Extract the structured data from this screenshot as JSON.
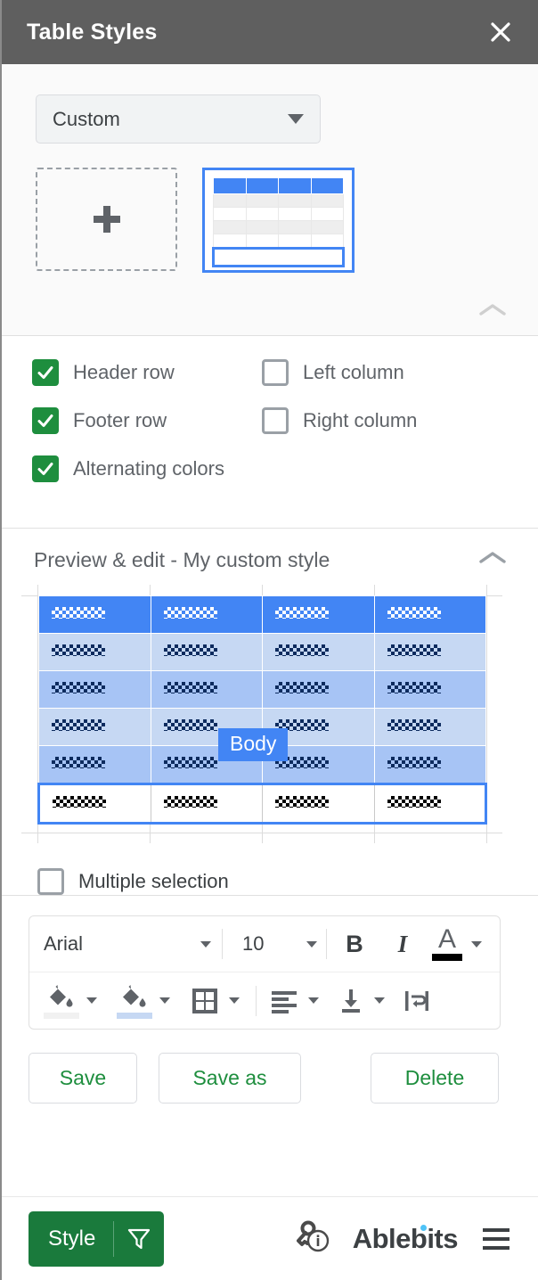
{
  "header": {
    "title": "Table Styles",
    "close_icon": "close-icon"
  },
  "gallery": {
    "style_select_value": "Custom",
    "add_style_label": "+",
    "collapse_icon": "chevron-up-icon"
  },
  "options": {
    "items": [
      {
        "label": "Header row",
        "checked": true
      },
      {
        "label": "Left column",
        "checked": false
      },
      {
        "label": "Footer row",
        "checked": true
      },
      {
        "label": "Right column",
        "checked": false
      },
      {
        "label": "Alternating colors",
        "checked": true
      }
    ]
  },
  "preview": {
    "title": "Preview & edit - My custom style",
    "collapse_icon": "chevron-up-icon",
    "selected_region_badge": "Body",
    "multiple_selection_label": "Multiple selection",
    "multiple_selection_checked": false,
    "table": {
      "columns": 4,
      "rows": [
        {
          "type": "header",
          "fill": "#4285f4"
        },
        {
          "type": "body",
          "fill": "#c6d8f3"
        },
        {
          "type": "body",
          "fill": "#a7c4f5"
        },
        {
          "type": "body",
          "fill": "#c6d8f3"
        },
        {
          "type": "body",
          "fill": "#a7c4f5"
        },
        {
          "type": "footer",
          "fill": "#ffffff"
        }
      ]
    }
  },
  "toolbar": {
    "font_family": "Arial",
    "font_size": "10",
    "bold_label": "B",
    "italic_label": "I",
    "font_color_label": "A",
    "font_color_swatch": "#000000",
    "fill_color_swatch": "#f1f1f1",
    "alt_fill_color_swatch": "#c6d8f3",
    "icons": [
      "fill-color-icon",
      "alternating-fill-color-icon",
      "borders-icon",
      "horizontal-align-icon",
      "vertical-align-icon",
      "text-wrap-icon"
    ]
  },
  "actions": {
    "save": "Save",
    "save_as": "Save as",
    "delete": "Delete"
  },
  "footer": {
    "style_button": "Style",
    "filter_icon": "funnel-icon",
    "license_icon": "key-info-icon",
    "brand": "Ablebits",
    "menu_icon": "hamburger-menu-icon"
  },
  "colors": {
    "header_bar": "#5f5f5f",
    "accent_blue": "#4285f4",
    "green": "#1e8e3e",
    "brand_green": "#1a7a3c"
  }
}
